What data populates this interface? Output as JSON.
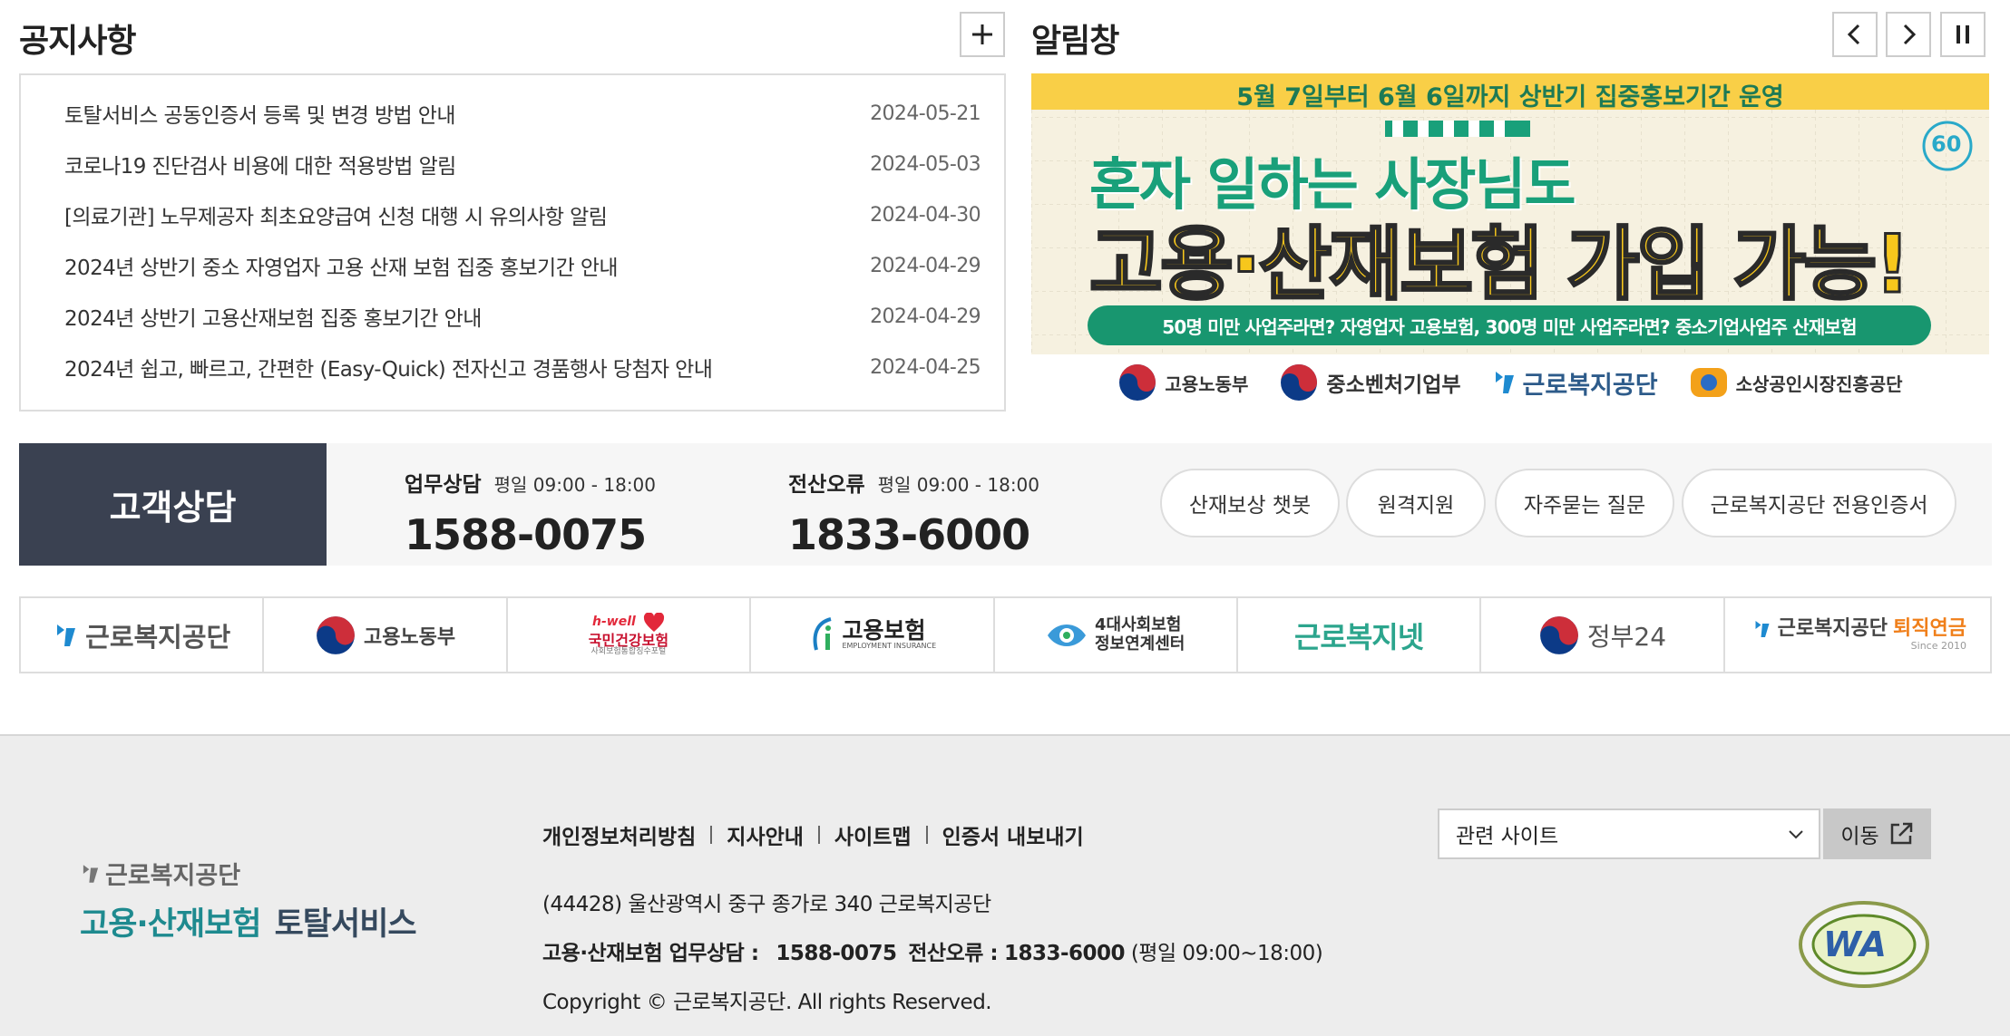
{
  "notice": {
    "title": "공지사항",
    "items": [
      {
        "text": "토탈서비스 공동인증서 등록 및 변경 방법 안내",
        "date": "2024-05-21"
      },
      {
        "text": "코로나19 진단검사 비용에 대한 적용방법 알림",
        "date": "2024-05-03"
      },
      {
        "text": "[의료기관] 노무제공자 최초요양급여 신청 대행 시 유의사항 알림",
        "date": "2024-04-30"
      },
      {
        "text": "2024년 상반기 중소 자영업자 고용 산재 보험 집중 홍보기간 안내",
        "date": "2024-04-29"
      },
      {
        "text": "2024년 상반기 고용산재보험 집중 홍보기간 안내",
        "date": "2024-04-29"
      },
      {
        "text": "2024년 쉽고, 빠르고, 간편한 (Easy-Quick) 전자신고 경품행사 당첨자 안내",
        "date": "2024-04-25"
      }
    ]
  },
  "alert": {
    "title": "알림창",
    "banner": {
      "top": "5월 7일부터 6월 6일까지 상반기 집중홍보기간 운영",
      "line1": "혼자 일하는 사장님도",
      "line2": "고용·산재보험 가입 가능!",
      "pill": "50명 미만 사업주라면? 자영업자 고용보험, 300명 미만 사업주라면? 중소기업사업주 산재보험",
      "orgs": [
        "고용노동부",
        "중소벤처기업부",
        "근로복지공단",
        "소상공인시장진흥공단"
      ],
      "badge": "60"
    }
  },
  "consult": {
    "label": "고객상담",
    "biz": {
      "title": "업무상담",
      "hours": "평일 09:00 - 18:00",
      "number": "1588-0075"
    },
    "it": {
      "title": "전산오류",
      "hours": "평일 09:00 - 18:00",
      "number": "1833-6000"
    },
    "buttons": [
      "산재보상 챗봇",
      "원격지원",
      "자주묻는 질문",
      "근로복지공단 전용인증서"
    ]
  },
  "logos": {
    "l1": "근로복지공단",
    "l2": "고용노동부",
    "l3a": "h-well",
    "l3b": "국민건강보험",
    "l3c": "사회보험통합징수포털",
    "l4a": "고용보험",
    "l4b": "EMPLOYMENT INSURANCE",
    "l5a": "4대사회보험",
    "l5b": "정보연계센터",
    "l6": "근로복지넷",
    "l7": "정부24",
    "l8a": "근로복지공단",
    "l8b": "퇴직연금",
    "l8c": "Since 2010"
  },
  "footer": {
    "logo_top": "근로복지공단",
    "logo_main": "고용·산재보험",
    "logo_sub": "토탈서비스",
    "links": [
      "개인정보처리방침",
      "지사안내",
      "사이트맵",
      "인증서 내보내기"
    ],
    "address": "(44428) 울산광역시 중구 종가로 340 근로복지공단",
    "phone_label": "고용·산재보험 업무상담 :",
    "phone_biz": "1588-0075",
    "phone_it_label": "전산오류 :",
    "phone_it": "1833-6000",
    "phone_hours": "(평일 09:00~18:00)",
    "copyright": "Copyright © 근로복지공단. All rights Reserved.",
    "select_label": "관련 사이트",
    "go_label": "이동",
    "wa_text": "WA"
  },
  "colors": {
    "navy": "#3a4151",
    "teal": "#1e8a8f",
    "yellow": "#f5c518",
    "green": "#19a07a"
  }
}
